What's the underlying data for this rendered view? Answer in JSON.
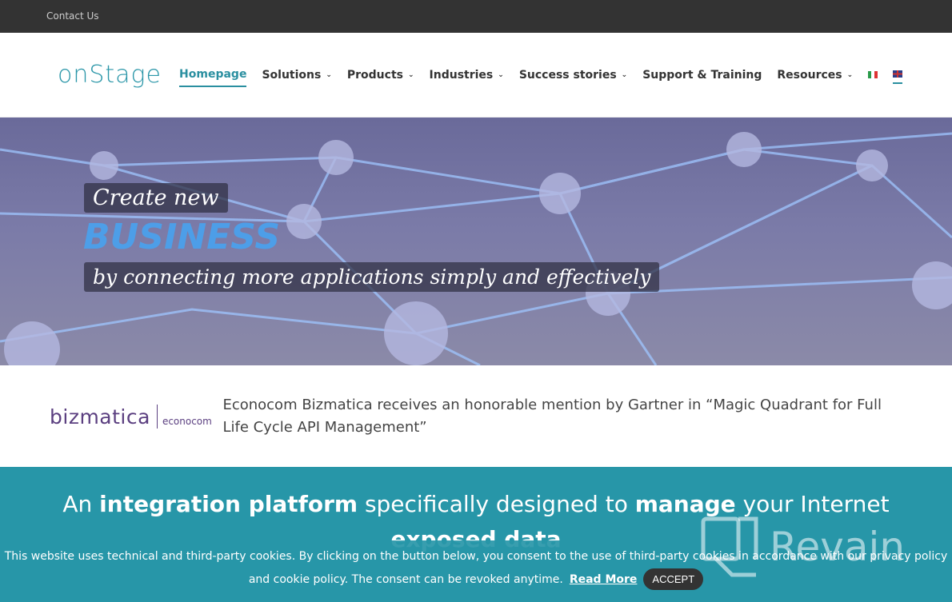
{
  "topbar": {
    "contact": "Contact Us"
  },
  "header": {
    "logo": "onStage",
    "nav": [
      {
        "label": "Homepage",
        "dropdown": false,
        "active": true
      },
      {
        "label": "Solutions",
        "dropdown": true
      },
      {
        "label": "Products",
        "dropdown": true
      },
      {
        "label": "Industries",
        "dropdown": true
      },
      {
        "label": "Success stories",
        "dropdown": true
      },
      {
        "label": "Support & Training",
        "dropdown": false
      },
      {
        "label": "Resources",
        "dropdown": true
      }
    ],
    "languages": [
      "it",
      "en"
    ]
  },
  "hero": {
    "line1": "Create new",
    "line2": "BUSINESS",
    "line3": "by connecting more applications simply and effectively"
  },
  "news": {
    "logo_main": "bizmatica",
    "logo_sub": "econocom",
    "text": "Econocom Bizmatica receives an honorable mention by Gartner in “Magic Quadrant for Full Life Cycle API Management”"
  },
  "tagline": {
    "p1": "An ",
    "b1": "integration platform",
    "p2": " specifically designed to ",
    "b2": "manage",
    "p3": " your Internet ",
    "b3": "exposed data"
  },
  "cookie": {
    "text1": "This website uses technical and third-party cookies. By clicking on the button below, you consent to the use of third-party cookies in accordance with our privacy policy",
    "text2": "and cookie policy. The consent can be revoked anytime.",
    "read_more": "Read More",
    "accept": "ACCEPT"
  },
  "watermark": "Revain",
  "colors": {
    "accent": "#2796a8",
    "topbar": "#333333",
    "brand_purple": "#5b3f80"
  }
}
